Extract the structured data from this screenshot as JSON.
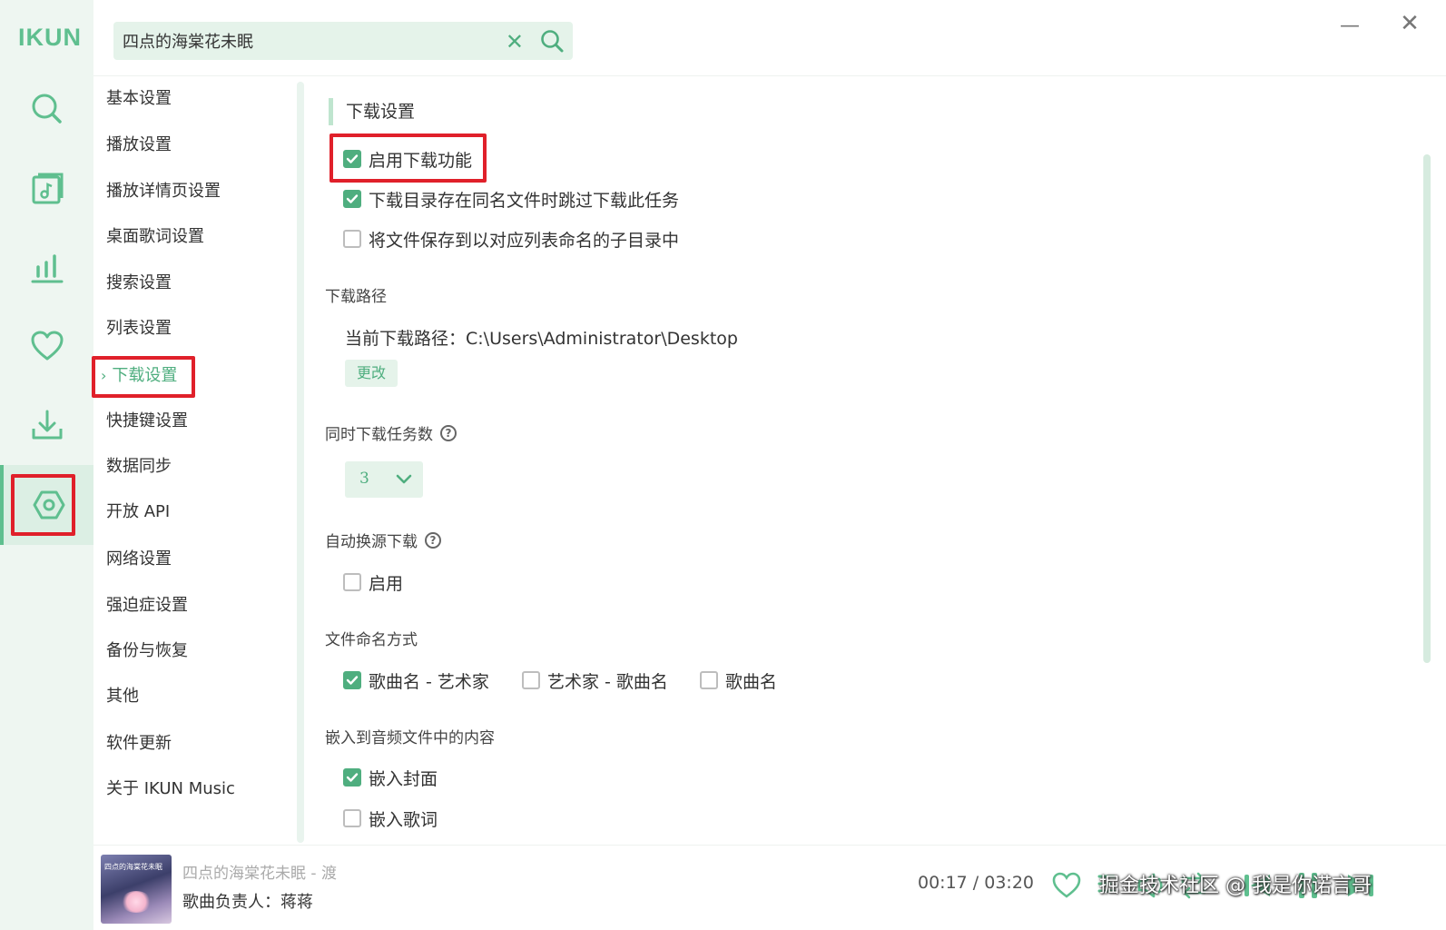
{
  "app": {
    "logo": "IKUN",
    "accent": "#5fbf8f"
  },
  "search": {
    "value": "四点的海棠花未眠"
  },
  "rail": [
    {
      "icon": "search-icon"
    },
    {
      "icon": "music-library-icon"
    },
    {
      "icon": "chart-icon"
    },
    {
      "icon": "heart-icon"
    },
    {
      "icon": "download-icon"
    },
    {
      "icon": "settings-icon",
      "active": true
    }
  ],
  "nav": {
    "items": [
      "基本设置",
      "播放设置",
      "播放详情页设置",
      "桌面歌词设置",
      "搜索设置",
      "列表设置",
      "下载设置",
      "快捷键设置",
      "数据同步",
      "开放 API",
      "网络设置",
      "强迫症设置",
      "备份与恢复",
      "其他",
      "软件更新",
      "关于 IKUN Music"
    ],
    "active_index": 6
  },
  "download": {
    "section_title": "下载设置",
    "enable_label": "启用下载功能",
    "enable_checked": true,
    "skip_label": "下载目录存在同名文件时跳过下载此任务",
    "skip_checked": true,
    "subdir_label": "将文件保存到以对应列表命名的子目录中",
    "subdir_checked": false,
    "path_group": "下载路径",
    "path_text": "当前下载路径：C:\\Users\\Administrator\\Desktop",
    "change_label": "更改",
    "concurrent_group": "同时下载任务数",
    "concurrent_value": "3",
    "auto_source_group": "自动换源下载",
    "auto_source_label": "启用",
    "auto_source_checked": false,
    "naming_group": "文件命名方式",
    "naming_options": [
      {
        "label": "歌曲名 - 艺术家",
        "checked": true
      },
      {
        "label": "艺术家 - 歌曲名",
        "checked": false
      },
      {
        "label": "歌曲名",
        "checked": false
      }
    ],
    "embed_group": "嵌入到音频文件中的内容",
    "embed_cover_label": "嵌入封面",
    "embed_cover_checked": true,
    "embed_lyrics_label": "嵌入歌词",
    "embed_lyrics_checked": false
  },
  "player": {
    "cover_text": "四点的海棠花未眠",
    "title": "四点的海棠花未眠 - 渡",
    "owner": "歌曲负责人：蒋蒋",
    "time": "00:17 / 03:20",
    "watermark": "掘金技术社区 @ 我是你诺言哥"
  }
}
